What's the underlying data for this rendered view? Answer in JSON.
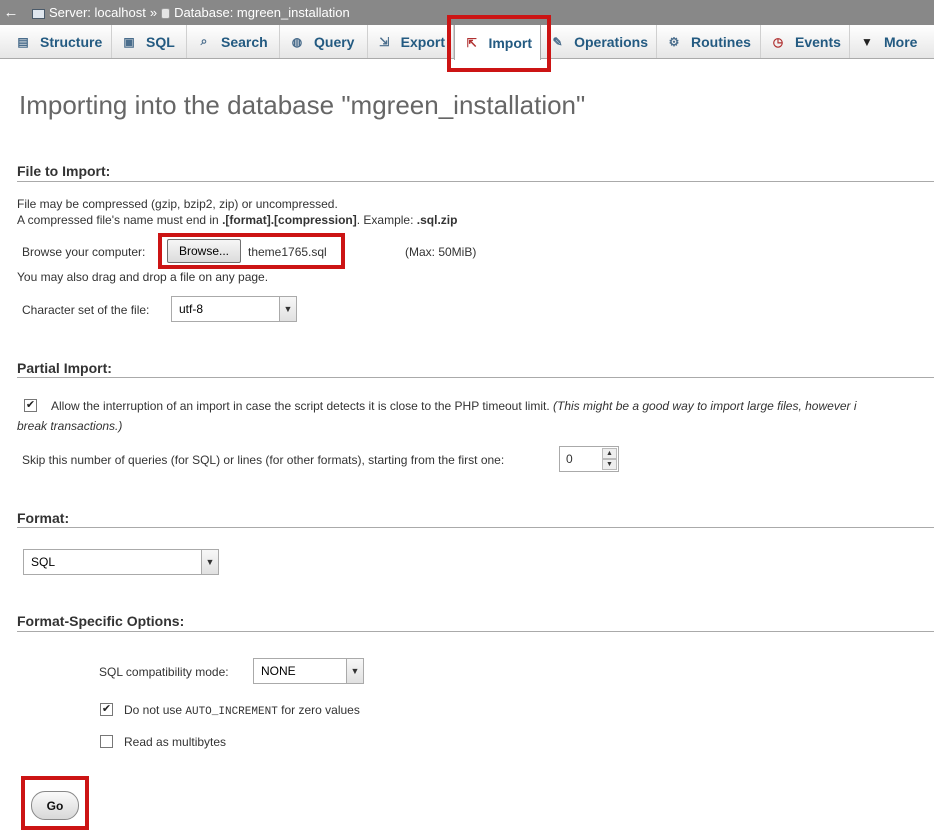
{
  "breadcrumb": {
    "back": "←",
    "server": "Server: localhost",
    "sep": "»",
    "database": "Database: mgreen_installation"
  },
  "tabs": [
    {
      "label": "Structure",
      "icon": "structure-icon"
    },
    {
      "label": "SQL",
      "icon": "sql-icon"
    },
    {
      "label": "Search",
      "icon": "search-icon"
    },
    {
      "label": "Query",
      "icon": "query-icon"
    },
    {
      "label": "Export",
      "icon": "export-icon"
    },
    {
      "label": "Import",
      "icon": "import-icon"
    },
    {
      "label": "Operations",
      "icon": "wrench-icon"
    },
    {
      "label": "Routines",
      "icon": "routines-icon"
    },
    {
      "label": "Events",
      "icon": "clock-icon"
    },
    {
      "label": "More",
      "icon": "chevron-down-icon"
    }
  ],
  "title": "Importing into the database \"mgreen_installation\"",
  "file_import": {
    "heading": "File to Import:",
    "line1": "File may be compressed (gzip, bzip2, zip) or uncompressed.",
    "line2_a": "A compressed file's name must end in ",
    "line2_b": ".[format].[compression]",
    "line2_c": ". Example: ",
    "line2_d": ".sql.zip",
    "browse_label": "Browse your computer:",
    "browse_button": "Browse...",
    "file_name": "theme1765.sql",
    "max_size": "(Max: 50MiB)",
    "drag_note": "You may also drag and drop a file on any page.",
    "charset_label": "Character set of the file:",
    "charset_value": "utf-8"
  },
  "partial": {
    "heading": "Partial Import:",
    "allow_label": "Allow the interruption of an import in case the script detects it is close to the PHP timeout limit.",
    "allow_note_1": "(This might be a good way to import large files, however i",
    "allow_note_2": "break transactions.)",
    "allow_checked": true,
    "skip_label": "Skip this number of queries (for SQL) or lines (for other formats), starting from the first one:",
    "skip_value": "0"
  },
  "format": {
    "heading": "Format:",
    "value": "SQL"
  },
  "options": {
    "heading": "Format-Specific Options:",
    "compat_label": "SQL compatibility mode:",
    "compat_value": "NONE",
    "no_auto_a": "Do not use ",
    "no_auto_code": "AUTO_INCREMENT",
    "no_auto_b": " for zero values",
    "no_auto_checked": true,
    "multibyte_label": "Read as multibytes",
    "multibyte_checked": false
  },
  "go_label": "Go",
  "colors": {
    "highlight": "#cc1414",
    "tab_text": "#235a81",
    "breadcrumb_bg": "#888888"
  }
}
